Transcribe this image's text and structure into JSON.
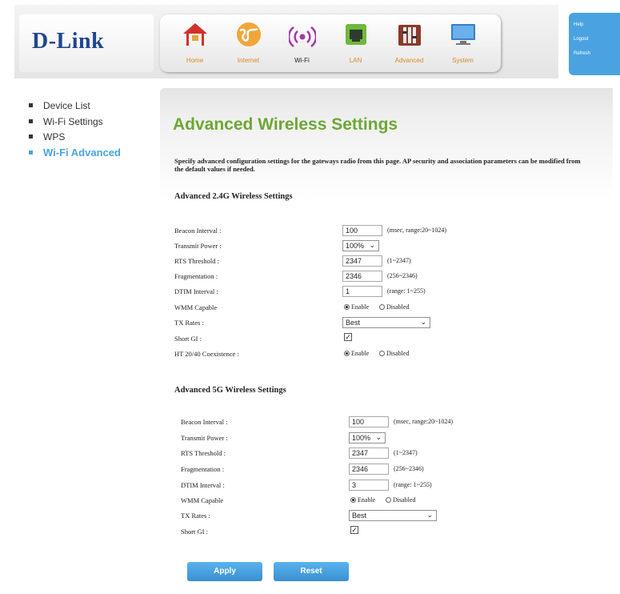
{
  "brand": {
    "logo": "D-Link",
    "color": "#1f4690"
  },
  "nav": {
    "items": [
      {
        "label": "Home",
        "icon": "home-icon"
      },
      {
        "label": "Internet",
        "icon": "globe-icon"
      },
      {
        "label": "Wi-Fi",
        "icon": "wifi-icon"
      },
      {
        "label": "LAN",
        "icon": "lan-icon"
      },
      {
        "label": "Advanced",
        "icon": "tools-icon"
      },
      {
        "label": "System",
        "icon": "monitor-icon"
      }
    ],
    "active": "Wi-Fi",
    "label_color": "#d98a20"
  },
  "help_panel": {
    "links": [
      "Help",
      "Logout",
      "Refresh"
    ],
    "color": "#4aa3e0"
  },
  "sidebar": {
    "items": [
      "Device List",
      "Wi-Fi Settings",
      "WPS",
      "Wi-Fi Advanced"
    ],
    "active": "Wi-Fi Advanced"
  },
  "page": {
    "title": "Advanced Wireless Settings",
    "intro": "Specify advanced configuration settings for the gateways radio from this page. AP security and association parameters can be modified from the default values if needed."
  },
  "section_24": {
    "heading": "Advanced 2.4G Wireless Settings",
    "beacon": {
      "label": "Beacon Interval :",
      "value": "100",
      "hint": "(msec, range:20~1024)"
    },
    "power": {
      "label": "Transmit Power :",
      "value": "100%"
    },
    "rts": {
      "label": "RTS Threshold :",
      "value": "2347",
      "hint": "(1~2347)"
    },
    "frag": {
      "label": "Fragmentation :",
      "value": "2346",
      "hint": "(256~2346)"
    },
    "dtim": {
      "label": "DTIM Interval :",
      "value": "1",
      "hint": "(range: 1~255)"
    },
    "wmm": {
      "label": "WMM Capable",
      "enable": "Enable",
      "disable": "Disabled",
      "selected": "Enable"
    },
    "tx": {
      "label": "TX Rates :",
      "value": "Best"
    },
    "sgi": {
      "label": "Short GI :",
      "checked": true
    },
    "ht": {
      "label": "HT 20/40 Coexistence :",
      "enable": "Enable",
      "disable": "Disabled",
      "selected": "Enable"
    }
  },
  "section_5": {
    "heading": "Advanced 5G Wireless Settings",
    "beacon": {
      "label": "Beacon Interval :",
      "value": "100",
      "hint": "(msec, range:20~1024)"
    },
    "power": {
      "label": "Transmit Power :",
      "value": "100%"
    },
    "rts": {
      "label": "RTS Threshold :",
      "value": "2347",
      "hint": "(1~2347)"
    },
    "frag": {
      "label": "Fragmentation :",
      "value": "2346",
      "hint": "(256~2346)"
    },
    "dtim": {
      "label": "DTIM Interval :",
      "value": "3",
      "hint": "(range: 1~255)"
    },
    "wmm": {
      "label": "WMM Capable",
      "enable": "Enable",
      "disable": "Disabled",
      "selected": "Enable"
    },
    "tx": {
      "label": "TX Rates :",
      "value": "Best"
    },
    "sgi": {
      "label": "Short GI :",
      "checked": true
    }
  },
  "buttons": {
    "apply": "Apply",
    "reset": "Reset",
    "color": "#4aa3e0"
  },
  "colors": {
    "title": "#6da833",
    "sidebar_active": "#4aa3e0"
  }
}
